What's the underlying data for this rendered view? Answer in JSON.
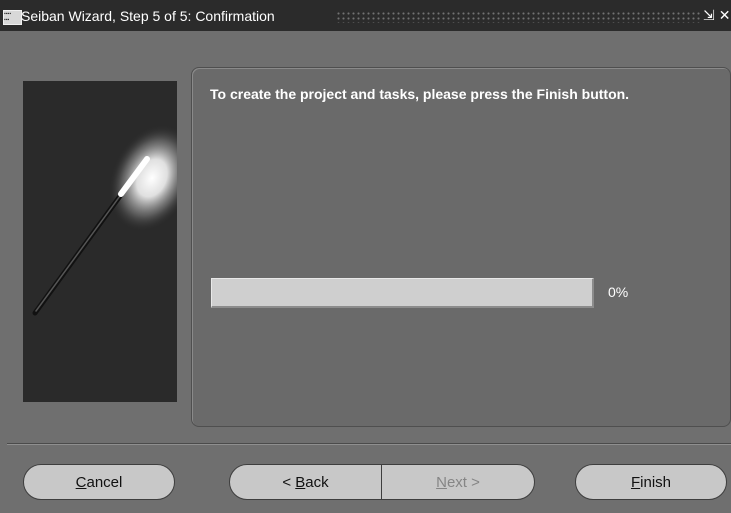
{
  "window": {
    "title": "Seiban Wizard, Step 5 of 5: Confirmation",
    "icon": "app-window-icon",
    "controls": {
      "minimize": "⇲",
      "close": "✕"
    }
  },
  "wizard": {
    "image": "magic-wand-icon",
    "instruction": "To create the project and tasks, please press the Finish button.",
    "progress": {
      "value": 0,
      "label": "0%"
    }
  },
  "buttons": {
    "cancel": {
      "accel": "C",
      "rest": "ancel"
    },
    "back": {
      "pre": "< ",
      "accel": "B",
      "rest": "ack"
    },
    "next": {
      "accel": "N",
      "rest": "ext >"
    },
    "finish": {
      "accel": "F",
      "rest": "inish"
    }
  },
  "colors": {
    "background": "#6f6f6f",
    "titlebar": "#2b2b2b",
    "button": "#c8c8c8",
    "progress_track": "#cfcfcf"
  }
}
